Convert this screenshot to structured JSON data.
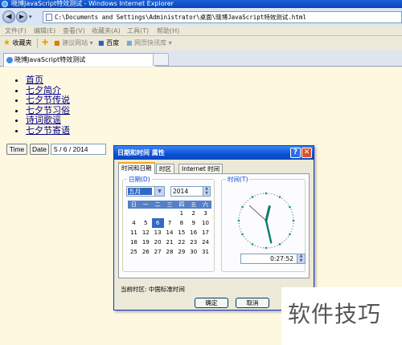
{
  "window": {
    "title": "晓博JavaScript特效测试 - Windows Internet Explorer"
  },
  "address": {
    "url": "C:\\Documents and Settings\\Administrator\\桌面\\晓博JavaScript特效测试.html"
  },
  "menu": {
    "items": [
      "文件(F)",
      "编辑(E)",
      "查看(V)",
      "收藏夹(A)",
      "工具(T)",
      "帮助(H)"
    ]
  },
  "favorites": {
    "label": "收藏夹",
    "suggested_sites": "建议网站",
    "baidu": "百度",
    "web_slices": "网页快讯库"
  },
  "tab": {
    "title": "晓博JavaScript特效测试"
  },
  "page": {
    "nav_links": [
      "首页",
      "七夕简介",
      "七夕节传说",
      "七夕节习俗",
      "诗词歌谣",
      "七夕节寄语"
    ],
    "time_button": "Time",
    "date_button": "Date",
    "date_value": "5 / 6 / 2014"
  },
  "dialog": {
    "title": "日期和时间 属性",
    "help_glyph": "?",
    "close_glyph": "✕",
    "tabs": [
      "时间和日期",
      "时区",
      "Internet 时间"
    ],
    "date_group_label": "日期(D)",
    "time_group_label": "时间(T)",
    "month": "五月",
    "year": "2014",
    "weekday_headers": [
      "日",
      "一",
      "二",
      "三",
      "四",
      "五",
      "六"
    ],
    "calendar_days": [
      "",
      "",
      "",
      "",
      "1",
      "2",
      "3",
      "4",
      "5",
      "6",
      "7",
      "8",
      "9",
      "10",
      "11",
      "12",
      "13",
      "14",
      "15",
      "16",
      "17",
      "18",
      "19",
      "20",
      "21",
      "22",
      "23",
      "24",
      "25",
      "26",
      "27",
      "28",
      "29",
      "30",
      "31"
    ],
    "selected_day": "6",
    "time": "0:27:52",
    "clock": {
      "hour": 0,
      "minute": 27,
      "second": 52
    },
    "timezone_label": "当前时区:  中国标准时间",
    "ok": "确定",
    "cancel": "取消"
  },
  "watermark": {
    "text": "软件技巧"
  },
  "colors": {
    "titlebar": "#0a43b8",
    "page_bg": "#fff8e0",
    "link": "#00008b",
    "dialog_title": "#0a51d3"
  }
}
